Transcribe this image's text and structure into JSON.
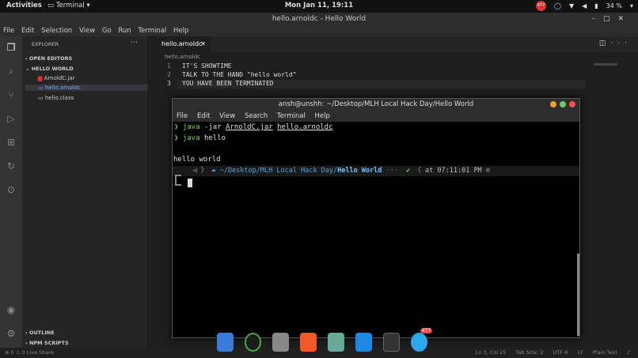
{
  "topbar": {
    "activities": "Activities",
    "app": "Terminal",
    "clock": "Mon Jan 11, 19:11",
    "notif_count": "477",
    "battery": "34 %"
  },
  "window": {
    "title": "hello.arnoldc - Hello World"
  },
  "menu": [
    "File",
    "Edit",
    "Selection",
    "View",
    "Go",
    "Run",
    "Terminal",
    "Help"
  ],
  "sidebar": {
    "title": "EXPLORER",
    "open_editors": "OPEN EDITORS",
    "folder": "HELLO WORLD",
    "files": [
      "ArnoldC.jar",
      "hello.arnoldc",
      "hello.class"
    ],
    "outline": "OUTLINE",
    "npm": "NPM SCRIPTS"
  },
  "editor": {
    "tab": "hello.arnoldc",
    "crumb": "hello.arnoldc",
    "lines": [
      {
        "n": "1",
        "t": "IT'S SHOWTIME"
      },
      {
        "n": "2",
        "t": "TALK TO THE HAND \"hello world\""
      },
      {
        "n": "3",
        "t": "YOU HAVE BEEN TERMINATED"
      }
    ]
  },
  "terminal": {
    "title": "ansh@unshh: ~/Desktop/MLH Local Hack Day/Hello World",
    "menu": [
      "File",
      "Edit",
      "View",
      "Search",
      "Terminal",
      "Help"
    ],
    "cmd1": {
      "a": "java",
      "b": " -jar ",
      "c": "ArnoldC.jar",
      "d": " ",
      "e": "hello.arnoldc"
    },
    "cmd2": {
      "a": "java",
      "b": " hello"
    },
    "output": "hello world",
    "prompt_path": "~/Desktop/MLH Local Hack Day/",
    "prompt_dir": "Hello World",
    "prompt_time": "at 07:11:01 PM"
  },
  "status": {
    "left": "⊗ 0 ⚠ 0   Live Share",
    "ln": "Ln 3, Col 25",
    "tab": "Tab Size: 2",
    "enc": "UTF-8",
    "eol": "LF",
    "lang": "Plain Text"
  },
  "dock": {
    "telegram_badge": "477"
  }
}
